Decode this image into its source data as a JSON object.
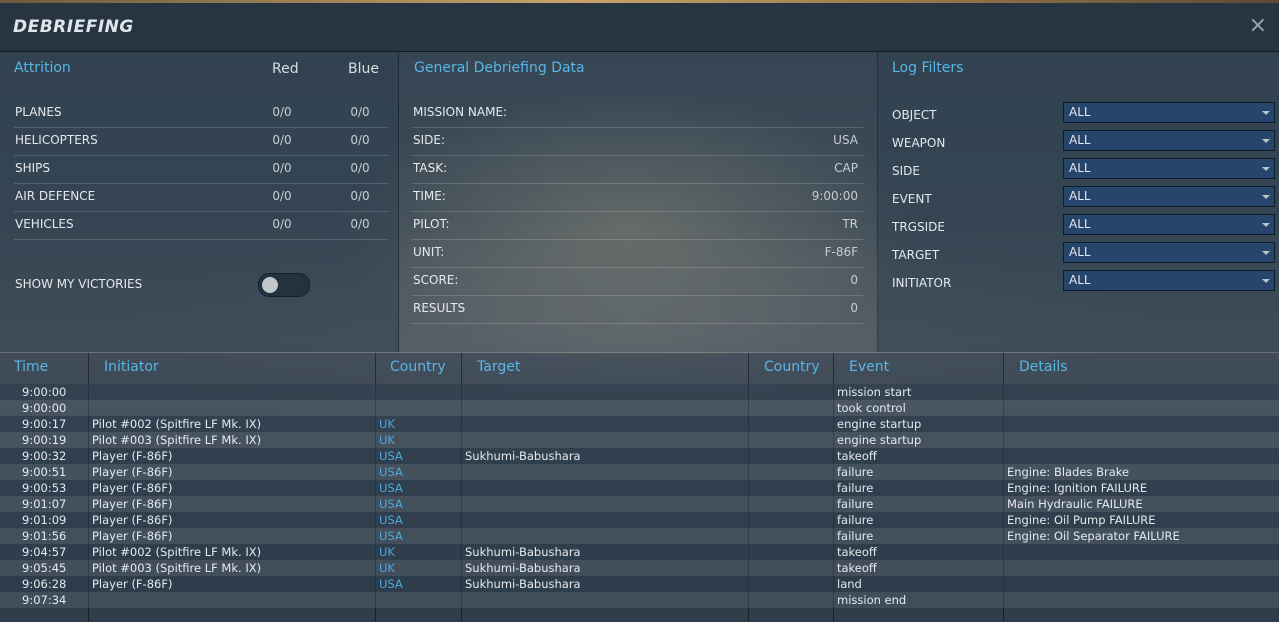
{
  "window": {
    "title": "DEBRIEFING",
    "close": "×"
  },
  "attrition": {
    "heading": "Attrition",
    "red_label": "Red",
    "blue_label": "Blue",
    "rows": [
      {
        "label": "PLANES",
        "red": "0/0",
        "blue": "0/0"
      },
      {
        "label": "HELICOPTERS",
        "red": "0/0",
        "blue": "0/0"
      },
      {
        "label": "SHIPS",
        "red": "0/0",
        "blue": "0/0"
      },
      {
        "label": "AIR DEFENCE",
        "red": "0/0",
        "blue": "0/0"
      },
      {
        "label": "VEHICLES",
        "red": "0/0",
        "blue": "0/0"
      }
    ],
    "show_victories_label": "SHOW MY VICTORIES",
    "show_victories_on": false
  },
  "general": {
    "heading": "General Debriefing Data",
    "rows": [
      {
        "label": "MISSION NAME:",
        "value": ""
      },
      {
        "label": "SIDE:",
        "value": "USA"
      },
      {
        "label": "TASK:",
        "value": "CAP"
      },
      {
        "label": "TIME:",
        "value": "9:00:00"
      },
      {
        "label": "PILOT:",
        "value": "TR"
      },
      {
        "label": "UNIT:",
        "value": "F-86F"
      },
      {
        "label": "SCORE:",
        "value": "0"
      },
      {
        "label": "RESULTS",
        "value": "0"
      }
    ]
  },
  "filters": {
    "heading": "Log Filters",
    "rows": [
      {
        "label": "OBJECT",
        "value": "ALL"
      },
      {
        "label": "WEAPON",
        "value": "ALL"
      },
      {
        "label": "SIDE",
        "value": "ALL"
      },
      {
        "label": "EVENT",
        "value": "ALL"
      },
      {
        "label": "TRGSIDE",
        "value": "ALL"
      },
      {
        "label": "TARGET",
        "value": "ALL"
      },
      {
        "label": "INITIATOR",
        "value": "ALL"
      }
    ]
  },
  "log": {
    "columns": {
      "time": "Time",
      "initiator": "Initiator",
      "country": "Country",
      "target": "Target",
      "target_country": "Country",
      "event": "Event",
      "details": "Details"
    },
    "rows": [
      {
        "time": "9:00:00",
        "initiator": "",
        "country": "",
        "target": "",
        "target_country": "",
        "event": "mission start",
        "details": ""
      },
      {
        "time": "9:00:00",
        "initiator": "",
        "country": "",
        "target": "",
        "target_country": "",
        "event": "took control",
        "details": ""
      },
      {
        "time": "9:00:17",
        "initiator": "Pilot #002 (Spitfire LF Mk. IX)",
        "country": "UK",
        "target": "",
        "target_country": "",
        "event": "engine startup",
        "details": ""
      },
      {
        "time": "9:00:19",
        "initiator": "Pilot #003 (Spitfire LF Mk. IX)",
        "country": "UK",
        "target": "",
        "target_country": "",
        "event": "engine startup",
        "details": ""
      },
      {
        "time": "9:00:32",
        "initiator": "Player (F-86F)",
        "country": "USA",
        "target": "Sukhumi-Babushara",
        "target_country": "",
        "event": "takeoff",
        "details": ""
      },
      {
        "time": "9:00:51",
        "initiator": "Player (F-86F)",
        "country": "USA",
        "target": "",
        "target_country": "",
        "event": "failure",
        "details": "Engine: Blades Brake"
      },
      {
        "time": "9:00:53",
        "initiator": "Player (F-86F)",
        "country": "USA",
        "target": "",
        "target_country": "",
        "event": "failure",
        "details": "Engine: Ignition FAILURE"
      },
      {
        "time": "9:01:07",
        "initiator": "Player (F-86F)",
        "country": "USA",
        "target": "",
        "target_country": "",
        "event": "failure",
        "details": "Main Hydraulic FAILURE"
      },
      {
        "time": "9:01:09",
        "initiator": "Player (F-86F)",
        "country": "USA",
        "target": "",
        "target_country": "",
        "event": "failure",
        "details": "Engine: Oil Pump FAILURE"
      },
      {
        "time": "9:01:56",
        "initiator": "Player (F-86F)",
        "country": "USA",
        "target": "",
        "target_country": "",
        "event": "failure",
        "details": "Engine: Oil Separator FAILURE"
      },
      {
        "time": "9:04:57",
        "initiator": "Pilot #002 (Spitfire LF Mk. IX)",
        "country": "UK",
        "target": "Sukhumi-Babushara",
        "target_country": "",
        "event": "takeoff",
        "details": ""
      },
      {
        "time": "9:05:45",
        "initiator": "Pilot #003 (Spitfire LF Mk. IX)",
        "country": "UK",
        "target": "Sukhumi-Babushara",
        "target_country": "",
        "event": "takeoff",
        "details": ""
      },
      {
        "time": "9:06:28",
        "initiator": "Player (F-86F)",
        "country": "USA",
        "target": "Sukhumi-Babushara",
        "target_country": "",
        "event": "land",
        "details": ""
      },
      {
        "time": "9:07:34",
        "initiator": "",
        "country": "",
        "target": "",
        "target_country": "",
        "event": "mission end",
        "details": ""
      }
    ]
  }
}
